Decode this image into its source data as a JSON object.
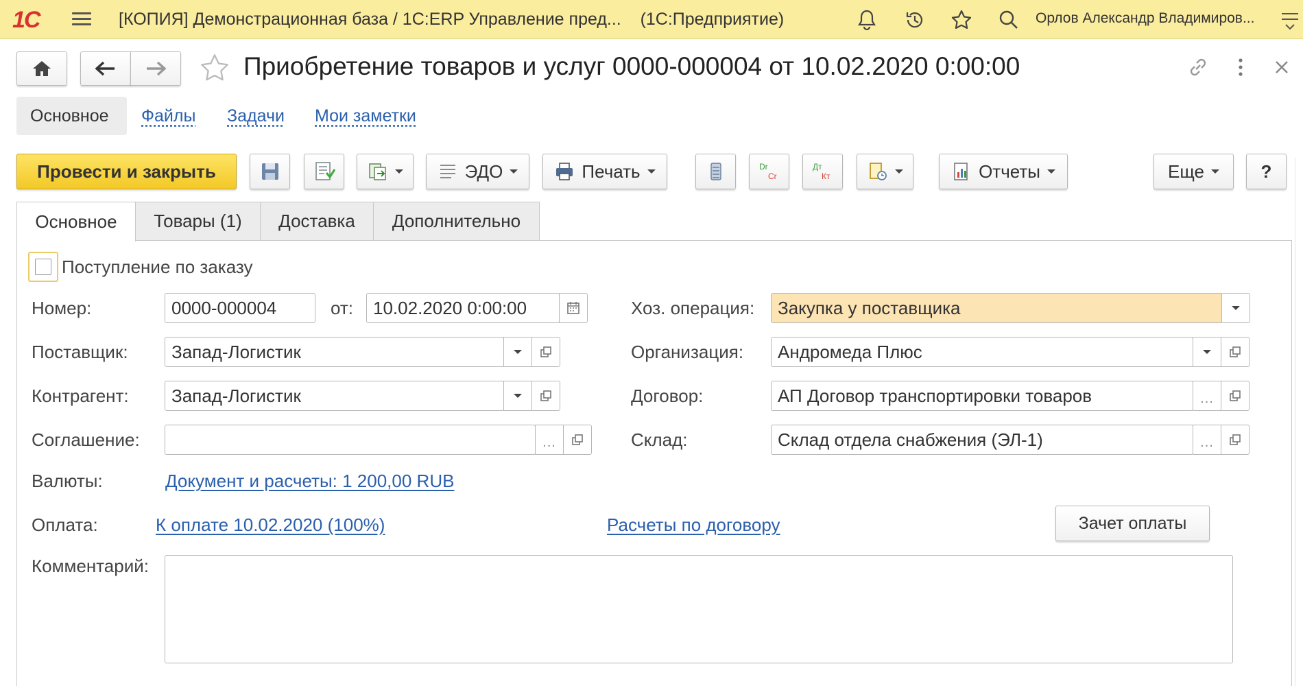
{
  "topbar": {
    "title": "[КОПИЯ] Демонстрационная база / 1С:ERP Управление пред...",
    "platform": "(1С:Предприятие)",
    "user": "Орлов Александр Владимиров..."
  },
  "header": {
    "title": "Приобретение товаров и услуг 0000-000004 от 10.02.2020 0:00:00"
  },
  "sections": [
    "Основное",
    "Файлы",
    "Задачи",
    "Мои заметки"
  ],
  "toolbar": {
    "post_close": "Провести и закрыть",
    "edo": "ЭДО",
    "print": "Печать",
    "reports": "Отчеты",
    "more": "Еще",
    "help": "?"
  },
  "tabs": [
    "Основное",
    "Товары (1)",
    "Доставка",
    "Дополнительно"
  ],
  "form": {
    "by_order_label": "Поступление по заказу",
    "number_label": "Номер:",
    "number_value": "0000-000004",
    "from_label": "от:",
    "date_value": "10.02.2020  0:00:00",
    "supplier_label": "Поставщик:",
    "supplier_value": "Запад-Логистик",
    "counterparty_label": "Контрагент:",
    "counterparty_value": "Запад-Логистик",
    "agreement_label": "Соглашение:",
    "agreement_value": "",
    "operation_label": "Хоз. операция:",
    "operation_value": "Закупка у поставщика",
    "organization_label": "Организация:",
    "organization_value": "Андромеда Плюс",
    "contract_label": "Договор:",
    "contract_value": "АП Договор транспортировки товаров",
    "warehouse_label": "Склад:",
    "warehouse_value": "Склад отдела снабжения (ЭЛ-1)",
    "currency_label": "Валюты:",
    "currency_link": "Документ и расчеты: 1 200,00 RUB",
    "payment_label": "Оплата:",
    "payment_link": "К оплате 10.02.2020 (100%)",
    "settlements_link": "Расчеты по договору",
    "offset_button": "Зачет оплаты",
    "comment_label": "Комментарий:",
    "comment_value": ""
  },
  "colors": {
    "topbar": "#fbed9e",
    "primary_button": "#f3c927",
    "link": "#2b60ad",
    "highlight_field": "#fde4b5"
  }
}
